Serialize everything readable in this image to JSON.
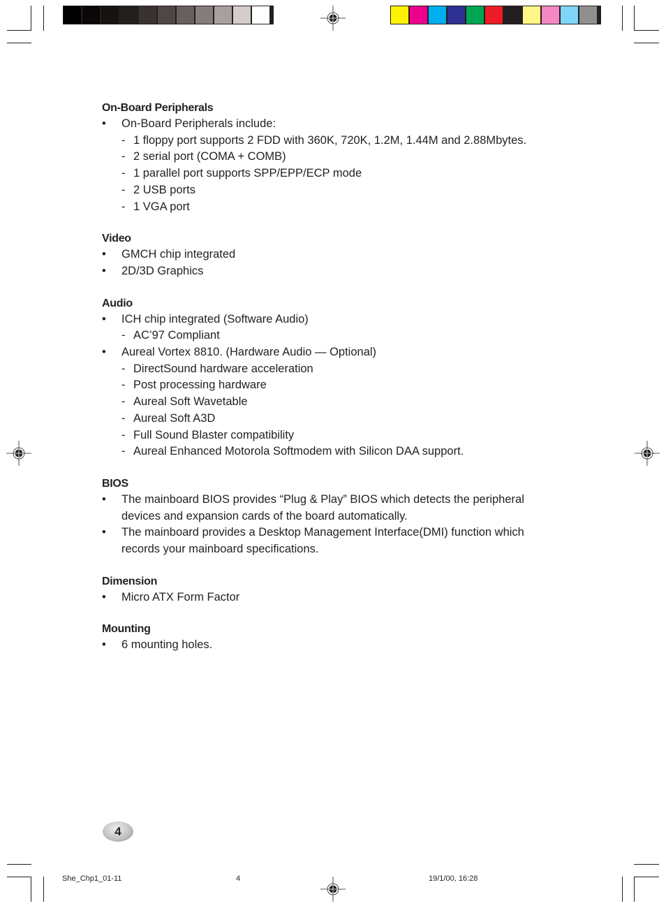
{
  "print_marks": {
    "grayscale_swatches": [
      "#000000",
      "#0a0806",
      "#161312",
      "#231f1d",
      "#3a3230",
      "#504745",
      "#686060",
      "#857d7a",
      "#a8a09e",
      "#d5cccc",
      "#ffffff"
    ],
    "color_swatches": [
      "#fff200",
      "#ec008c",
      "#00aeef",
      "#2e3192",
      "#00a651",
      "#ed1c24",
      "#231f20",
      "#fff685",
      "#f587c4",
      "#7fd6f7",
      "#8f8f8f"
    ]
  },
  "sections": [
    {
      "title": "On-Board Peripherals",
      "items": [
        {
          "text": "On-Board Peripherals include:",
          "subitems": [
            "1 floppy port supports 2 FDD with 360K, 720K, 1.2M, 1.44M and 2.88Mbytes.",
            "2 serial port (COMA + COMB)",
            "1 parallel port supports SPP/EPP/ECP mode",
            "2 USB ports",
            "1 VGA port"
          ]
        }
      ]
    },
    {
      "title": "Video",
      "items": [
        {
          "text": "GMCH chip integrated"
        },
        {
          "text": "2D/3D Graphics"
        }
      ]
    },
    {
      "title": "Audio",
      "items": [
        {
          "text": "ICH chip integrated (Software Audio)",
          "subitems": [
            "AC’97 Compliant"
          ]
        },
        {
          "text": "Aureal Vortex 8810. (Hardware Audio — Optional)",
          "subitems": [
            "DirectSound hardware acceleration",
            "Post processing hardware",
            "Aureal Soft Wavetable",
            "Aureal Soft A3D",
            "Full Sound Blaster compatibility",
            "Aureal Enhanced Motorola Softmodem with Silicon DAA support."
          ]
        }
      ]
    },
    {
      "title": "BIOS",
      "items": [
        {
          "text": "The mainboard BIOS provides “Plug & Play” BIOS which detects the peripheral devices and expansion cards of the board automatically."
        },
        {
          "text": "The mainboard provides a Desktop Management Interface(DMI) function which records your mainboard specifications."
        }
      ]
    },
    {
      "title": "Dimension",
      "items": [
        {
          "text": "Micro ATX Form Factor"
        }
      ]
    },
    {
      "title": "Mounting",
      "items": [
        {
          "text": "6 mounting holes."
        }
      ]
    }
  ],
  "page_number": "4",
  "slug": {
    "file": "She_Chp1_01-11",
    "page": "4",
    "datetime": "19/1/00, 16:28"
  }
}
